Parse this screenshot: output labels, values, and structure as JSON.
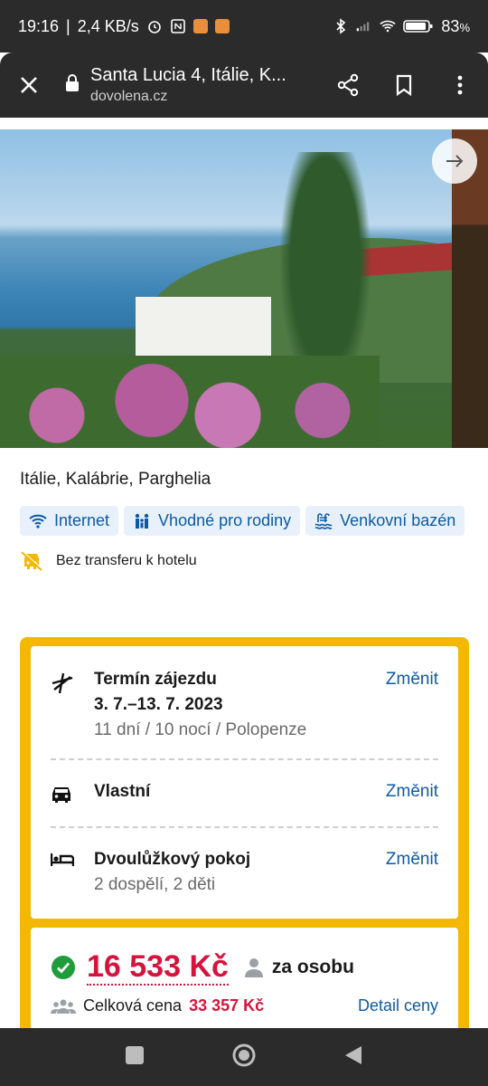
{
  "status_bar": {
    "time": "19:16",
    "speed": "2,4 KB/s",
    "battery": "83"
  },
  "browser": {
    "title": "Santa Lucia 4, Itálie, K...",
    "host": "dovolena.cz"
  },
  "hotel": {
    "location": "Itálie, Kalábrie, Parghelia",
    "features": [
      {
        "label": "Internet",
        "icon": "wifi-icon"
      },
      {
        "label": "Vhodné pro rodiny",
        "icon": "family-icon"
      },
      {
        "label": "Venkovní bazén",
        "icon": "pool-icon"
      }
    ],
    "transfer": "Bez transferu k hotelu"
  },
  "trip": {
    "term_label": "Termín zájezdu",
    "dates": "3. 7.–13. 7. 2023",
    "duration": "11 dní / 10 nocí / Polopenze",
    "transport": "Vlastní",
    "room": "Dvoulůžkový pokoj",
    "occupants": "2 dospělí, 2 děti",
    "change_label": "Změnit"
  },
  "price": {
    "per_person": "16 533 Kč",
    "per_person_label": "za osobu",
    "total_label": "Celková cena",
    "total": "33 357 Kč",
    "detail_label": "Detail ceny"
  },
  "colors": {
    "accent": "#f5b800",
    "price": "#d6133c",
    "link": "#0b5aa6"
  }
}
